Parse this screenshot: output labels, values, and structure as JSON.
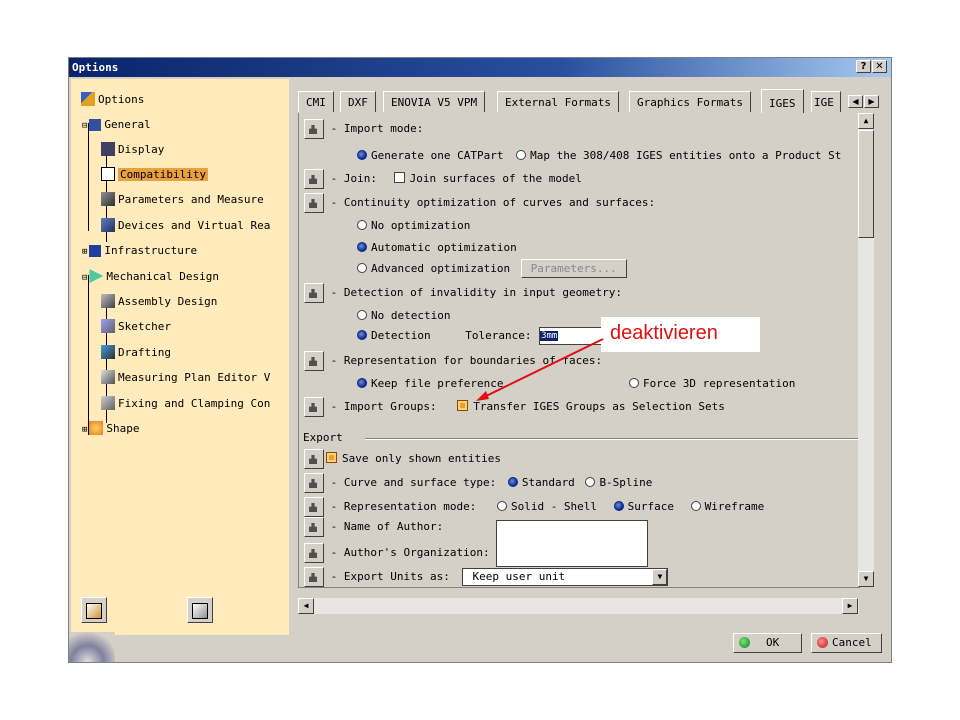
{
  "window": {
    "title": "Options",
    "help_label": "?",
    "close_label": "✕"
  },
  "tree": [
    {
      "label": "Options"
    },
    {
      "label": "General"
    },
    {
      "label": "Display"
    },
    {
      "label": "Compatibility"
    },
    {
      "label": "Parameters and Measure"
    },
    {
      "label": "Devices and Virtual Rea"
    },
    {
      "label": "Infrastructure"
    },
    {
      "label": "Mechanical Design"
    },
    {
      "label": "Assembly Design"
    },
    {
      "label": "Sketcher"
    },
    {
      "label": "Drafting"
    },
    {
      "label": "Measuring Plan Editor V"
    },
    {
      "label": "Fixing and Clamping Con"
    },
    {
      "label": "Shape"
    }
  ],
  "tabs": [
    "CMI",
    "DXF",
    "ENOVIA V5 VPM",
    "External Formats",
    "Graphics Formats",
    "IGES",
    "IGE"
  ],
  "import": {
    "mode_label": "Import mode:",
    "generate_one": "Generate one CATPart",
    "map_entities": "Map the 308/408 IGES entities onto a Product St",
    "join_label": "Join:",
    "join_surfaces": "Join surfaces of the model",
    "continuity_label": "Continuity optimization of curves and surfaces:",
    "no_opt": "No optimization",
    "auto_opt": "Automatic optimization",
    "adv_opt": "Advanced optimization",
    "parameters_btn": "Parameters...",
    "invalidity_label": "Detection of invalidity in input geometry:",
    "no_detection": "No detection",
    "detection": "Detection",
    "tolerance_label": "Tolerance:",
    "tolerance_value": "3mm",
    "representation_label": "Representation for boundaries of faces:",
    "keep_pref": "Keep file preference",
    "force_3d": "Force 3D representation",
    "groups_label": "- Import Groups:",
    "transfer_groups": "Transfer IGES Groups as Selection Sets"
  },
  "export": {
    "section_label": "Export",
    "save_shown": "Save only shown entities",
    "curve_type_label": "Curve and surface type:",
    "standard": "Standard",
    "bspline": "B-Spline",
    "rep_mode_label": "Representation mode:",
    "solid_shell": "Solid - Shell",
    "surface": "Surface",
    "wireframe": "Wireframe",
    "author_label": "Name of Author:",
    "org_label": "Author's Organization:",
    "units_label": "Export Units as:",
    "units_value": "Keep user unit"
  },
  "buttons": {
    "ok": "OK",
    "cancel": "Cancel"
  },
  "annotation": {
    "text": "deaktivieren",
    "color": "#e01010"
  }
}
